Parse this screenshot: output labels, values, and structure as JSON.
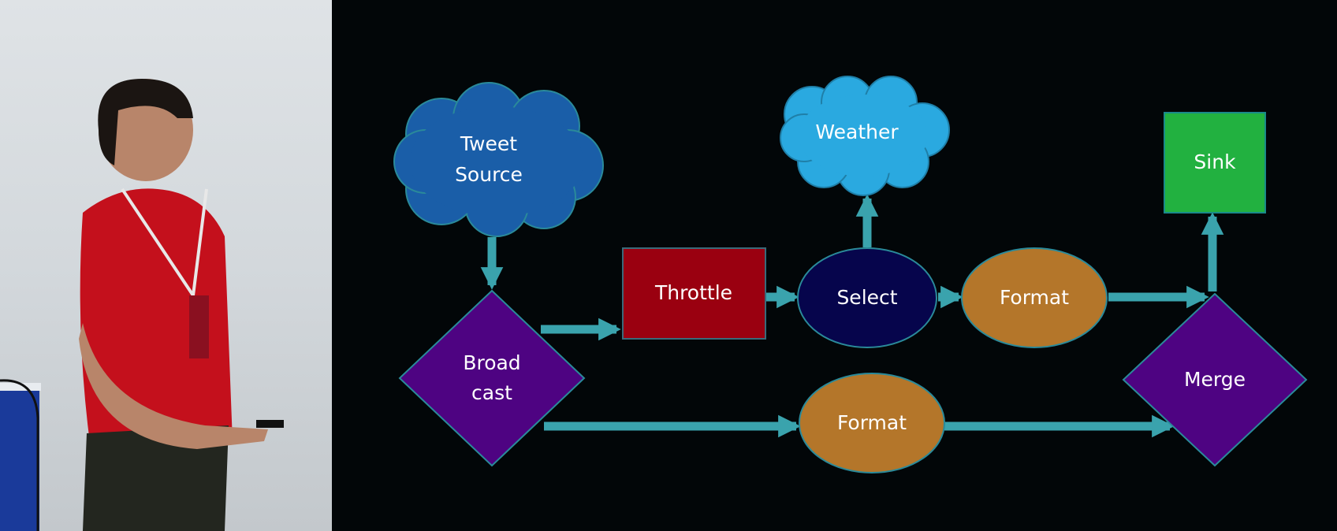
{
  "nodes": {
    "tweet_source": {
      "line1": "Tweet",
      "line2": "Source"
    },
    "weather": {
      "label": "Weather"
    },
    "sink": {
      "label": "Sink"
    },
    "throttle": {
      "label": "Throttle"
    },
    "select": {
      "label": "Select"
    },
    "format_top": {
      "label": "Format"
    },
    "broadcast": {
      "line1": "Broad",
      "line2": "cast"
    },
    "format_bottom": {
      "label": "Format"
    },
    "merge": {
      "label": "Merge"
    }
  },
  "edges": [
    {
      "from": "Tweet Source",
      "to": "Broadcast"
    },
    {
      "from": "Broadcast",
      "to": "Throttle"
    },
    {
      "from": "Throttle",
      "to": "Select"
    },
    {
      "from": "Select",
      "to": "Weather"
    },
    {
      "from": "Select",
      "to": "Format"
    },
    {
      "from": "Format",
      "to": "Merge"
    },
    {
      "from": "Merge",
      "to": "Sink"
    },
    {
      "from": "Broadcast",
      "to": "Format"
    },
    {
      "from": "Format",
      "to": "Merge"
    }
  ],
  "colors": {
    "tweet_source": "#1a5ea8",
    "weather": "#2aa9e0",
    "sink": "#22b140",
    "throttle": "#9a0010",
    "select": "#06054c",
    "format": "#b4762a",
    "diamond": "#4e0382",
    "arrow": "#3aa3ad",
    "background": "#020608"
  }
}
